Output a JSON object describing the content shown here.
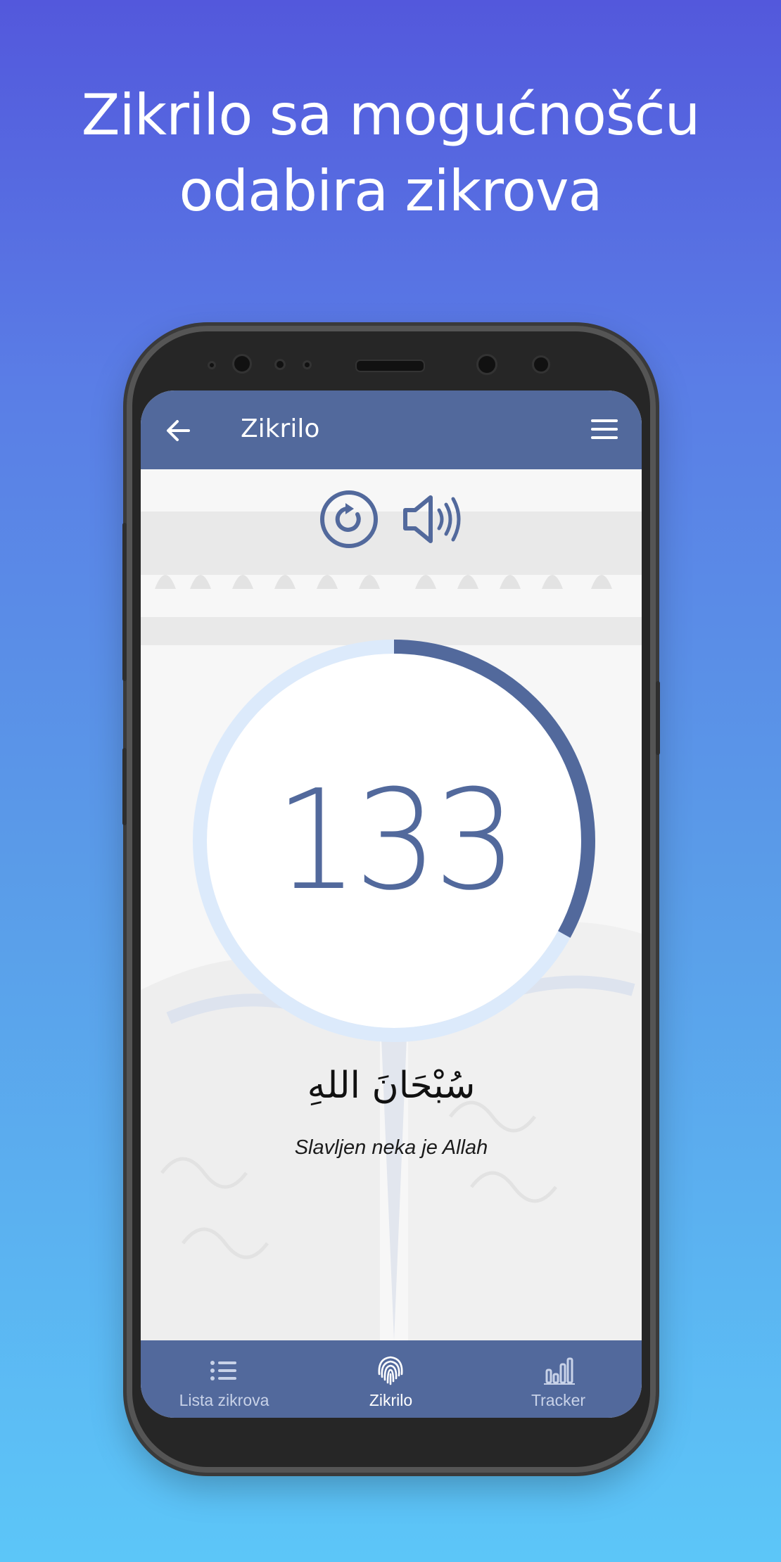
{
  "headline": {
    "line1": "Zikrilo sa mogućnošću",
    "line2": "odabira zikrova"
  },
  "appbar": {
    "title": "Zikrilo",
    "back_icon": "arrow-left-icon",
    "menu_icon": "hamburger-menu-icon"
  },
  "controls": {
    "reset_icon": "refresh-icon",
    "sound_icon": "speaker-volume-icon"
  },
  "counter": {
    "value": "133",
    "progress_fraction": 0.33,
    "colors": {
      "progress": "#52699c",
      "track": "#dceafb"
    }
  },
  "dhikr": {
    "arabic": "سُبْحَانَ اللهِ",
    "translation": "Slavljen neka je Allah"
  },
  "bottom_nav": {
    "items": [
      {
        "label": "Lista zikrova",
        "icon": "list-icon",
        "active": false
      },
      {
        "label": "Zikrilo",
        "icon": "fingerprint-icon",
        "active": true
      },
      {
        "label": "Tracker",
        "icon": "bar-chart-icon",
        "active": false
      }
    ]
  },
  "colors": {
    "primary": "#52699c",
    "gradient_top": "#5358dc",
    "gradient_bottom": "#5cc6f8"
  }
}
